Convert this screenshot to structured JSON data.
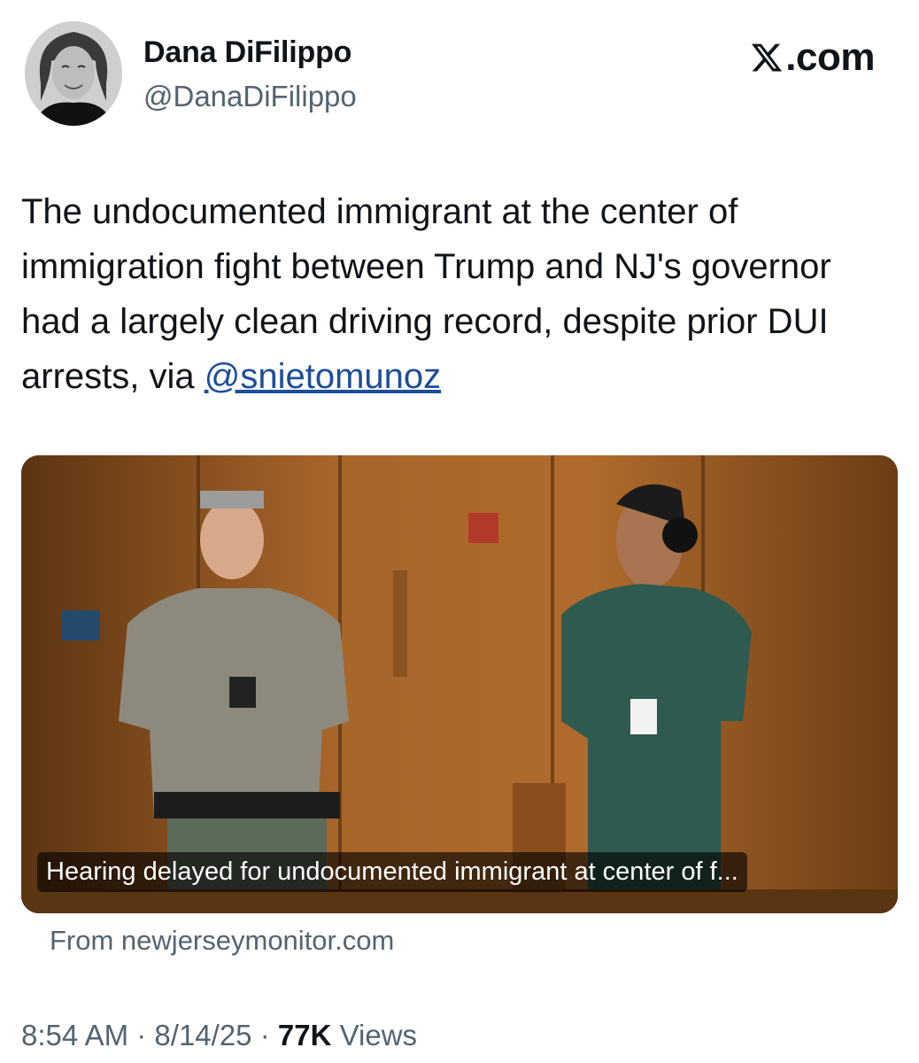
{
  "author": {
    "display_name": "Dana DiFilippo",
    "handle": "@DanaDiFilippo",
    "avatar_icon": "avatar-photo"
  },
  "brand": {
    "label": ".com",
    "logo_icon": "x-logo-icon"
  },
  "tweet": {
    "text_before": "The undocumented immigrant at the center of immigration fight between Trump and NJ's governor had a largely clean driving record, despite prior DUI arrests, via ",
    "mention": "@snietomunoz"
  },
  "card": {
    "caption": "Hearing delayed for undocumented immigrant at center of f...",
    "source": "From newjerseymonitor.com"
  },
  "meta": {
    "time": "8:54 AM",
    "separator": "·",
    "date": "8/14/25",
    "views_count": "77K",
    "views_label": "Views"
  },
  "colors": {
    "text": "#0f1419",
    "secondary": "#536471",
    "mention": "#1d4e9a"
  }
}
